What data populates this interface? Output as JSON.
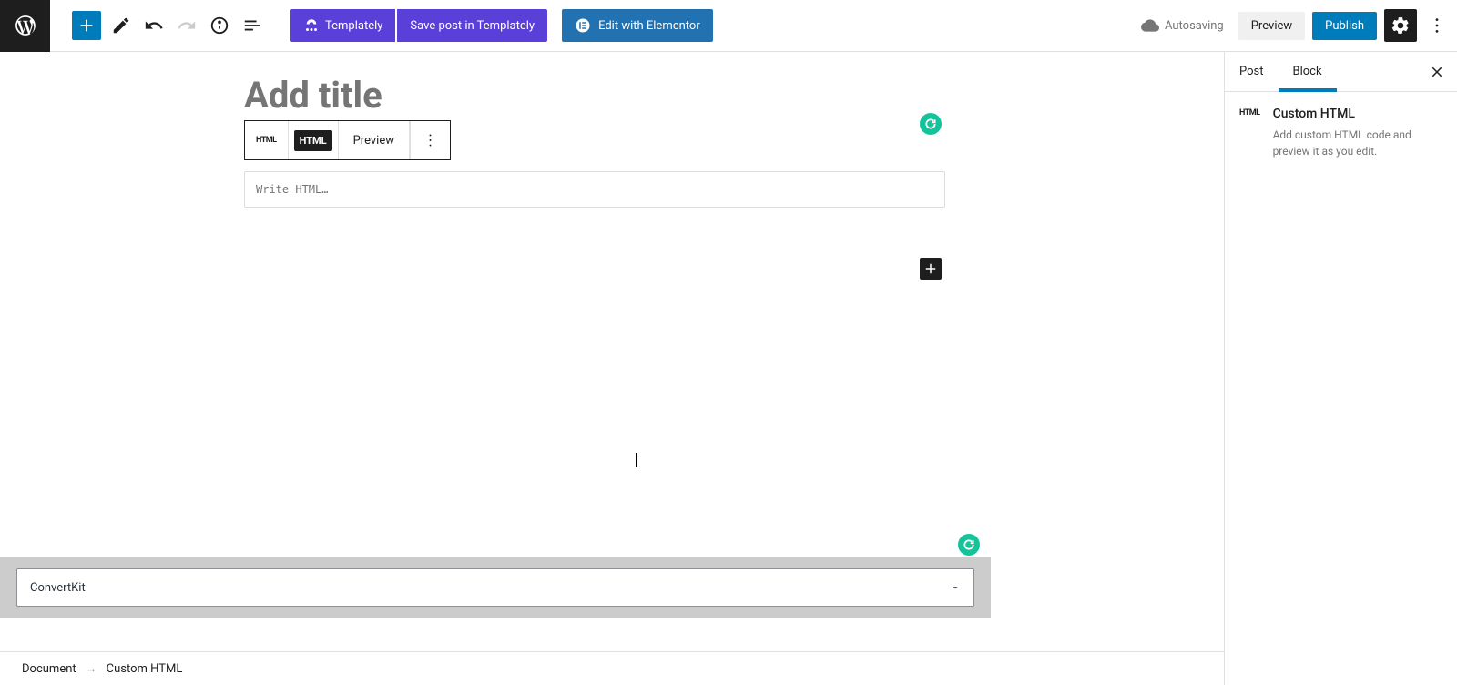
{
  "toolbar": {
    "templately": "Templately",
    "templately_save": "Save post in Templately",
    "elementor": "Edit with Elementor",
    "autosave": "Autosaving",
    "preview": "Preview",
    "publish": "Publish"
  },
  "editor": {
    "title_placeholder": "Add title",
    "block_toolbar": {
      "icon": "HTML",
      "html": "HTML",
      "preview": "Preview"
    },
    "html_placeholder": "Write HTML…"
  },
  "convertkit": {
    "label": "ConvertKit"
  },
  "breadcrumb": {
    "root": "Document",
    "current": "Custom HTML"
  },
  "sidebar": {
    "tab_post": "Post",
    "tab_block": "Block",
    "block_icon": "HTML",
    "block_title": "Custom HTML",
    "block_desc": "Add custom HTML code and preview it as you edit."
  }
}
